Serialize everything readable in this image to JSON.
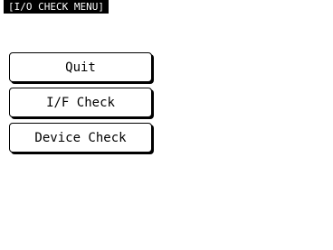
{
  "header": {
    "title": "[I/O CHECK MENU]"
  },
  "menu": {
    "items": [
      {
        "label": "Quit"
      },
      {
        "label": "I/F Check"
      },
      {
        "label": "Device Check"
      }
    ]
  },
  "colors": {
    "background": "#ffffff",
    "foreground": "#000000",
    "title_bg": "#000000",
    "title_fg": "#ffffff"
  }
}
